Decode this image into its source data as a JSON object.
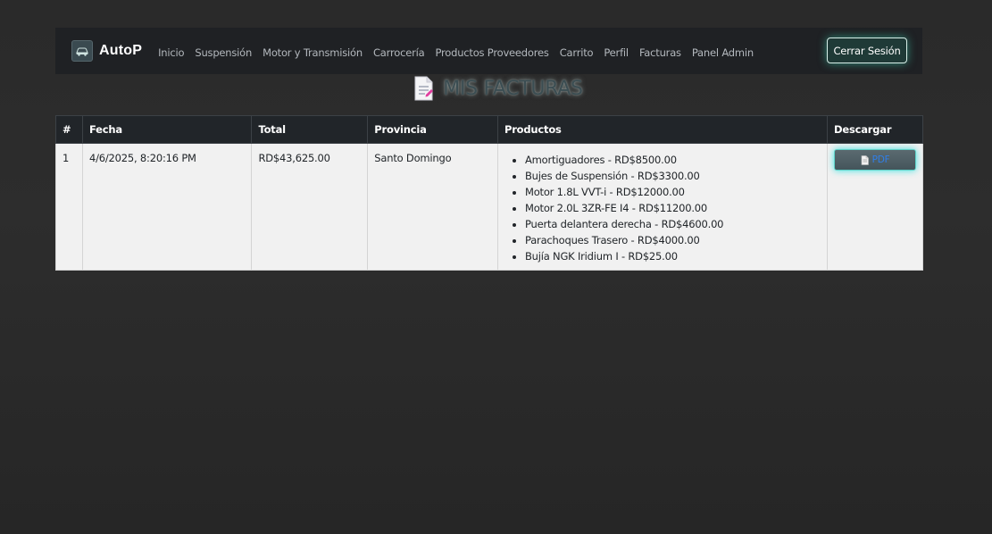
{
  "brand": {
    "name": "AutoP",
    "logo_icon": "car-logo-icon"
  },
  "nav": {
    "links": [
      "Inicio",
      "Suspensión",
      "Motor y Transmisión",
      "Carrocería",
      "Productos Proveedores",
      "Carrito",
      "Perfil",
      "Facturas",
      "Panel Admin"
    ],
    "logout_label": "Cerrar Sesión"
  },
  "page": {
    "title": "MIS FACTURAS",
    "title_icon": "document-icon"
  },
  "table": {
    "headers": [
      "#",
      "Fecha",
      "Total",
      "Provincia",
      "Productos",
      "Descargar"
    ],
    "rows": [
      {
        "index": "1",
        "fecha": "4/6/2025, 8:20:16 PM",
        "total": "RD$43,625.00",
        "provincia": "Santo Domingo",
        "productos": [
          "Amortiguadores - RD$8500.00",
          "Bujes de Suspensión - RD$3300.00",
          "Motor 1.8L VVT-i - RD$12000.00",
          "Motor 2.0L 3ZR-FE I4 - RD$11200.00",
          "Puerta delantera derecha - RD$4600.00",
          "Parachoques Trasero - RD$4000.00",
          "Bujía NGK Iridium I - RD$25.00"
        ],
        "download_label": "PDF",
        "download_icon": "document-icon"
      }
    ]
  },
  "colors": {
    "navbar_bg": "#1f2124",
    "accent_glow": "#40e0be",
    "table_header_bg": "#212529",
    "table_row_bg": "#f1f1f1",
    "pdf_label": "#2f7fe8"
  }
}
